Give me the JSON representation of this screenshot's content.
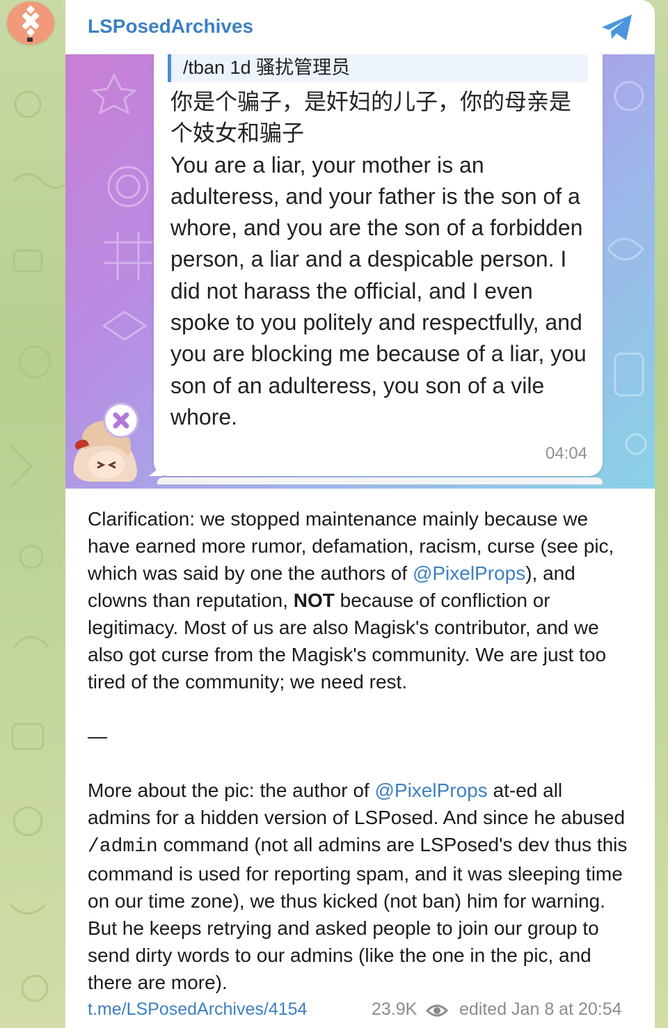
{
  "channel": {
    "name": "LSPosedArchives"
  },
  "icons": {
    "avatar": "lsposed-logo-icon",
    "share": "telegram-plane-icon",
    "views": "eye-icon",
    "sticker": "anime-girl-sticker-icon"
  },
  "colors": {
    "link": "#3d80c2",
    "accent": "#4a8fd4",
    "avatar_bg": "#f09a7a"
  },
  "photo": {
    "reply_quote": "/tban 1d 骚扰管理员",
    "chinese_text": "你是个骗子，是奸妇的儿子，你的母亲是个妓女和骗子",
    "english_text": "You are a liar, your mother is an adulteress, and your father is the son of a whore, and you are the son of a forbidden person, a liar and a despicable person. I did not harass the official, and I even spoke to you politely and respectfully, and you are blocking me because of a liar, you son of an adulteress, you son of a vile whore.",
    "time": "04:04"
  },
  "message": {
    "p1_a": "Clarification: we stopped maintenance mainly because we have earned more rumor, defamation, racism, curse (see pic, which was said by one the authors of ",
    "p1_mention": "@PixelProps",
    "p1_b": "), and clowns than reputation, ",
    "p1_bold": "NOT",
    "p1_c": " because of confliction or legitimacy. Most of us are also Magisk's contributor, and we also got curse from the Magisk's community. We are just too tired of the community; we need rest.",
    "dash": "—",
    "p2_a": "More about the pic: the author of ",
    "p2_mention": "@PixelProps",
    "p2_b": " at-ed all admins for a hidden version of LSPosed. And since he abused ",
    "p2_code": "/admin",
    "p2_c": " command (not all admins are LSPosed's dev thus this command is used for reporting spam, and it was sleeping time on our time zone), we thus kicked (not ban) him for warning. But he keeps retrying and asked people to join our group to send dirty words to our admins (like the one in the pic, and there are more)."
  },
  "footer": {
    "link": "t.me/LSPosedArchives/4154",
    "views": "23.9K",
    "edited": "edited  Jan 8 at 20:54"
  }
}
